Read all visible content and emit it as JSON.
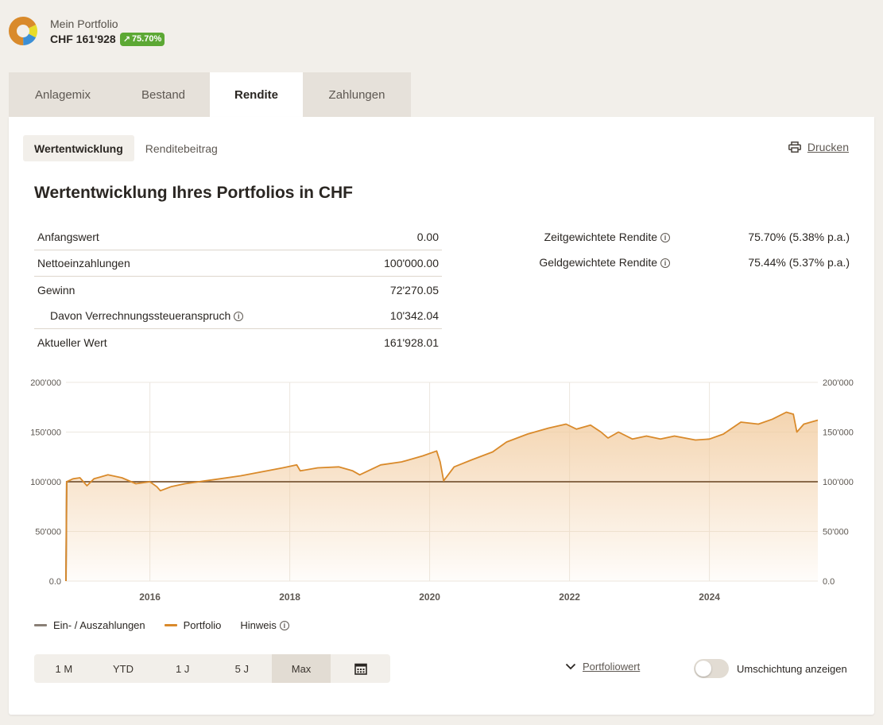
{
  "header": {
    "title": "Mein Portfolio",
    "value": "CHF 161'928",
    "badge": "75.70%",
    "badge_icon": "arrow-up-right-icon"
  },
  "tabs": [
    "Anlagemix",
    "Bestand",
    "Rendite",
    "Zahlungen"
  ],
  "active_tab": "Rendite",
  "subtabs": [
    "Wertentwicklung",
    "Renditebeitrag"
  ],
  "active_subtab": "Wertentwicklung",
  "print_label": "Drucken",
  "section_title": "Wertentwicklung Ihres Portfolios in CHF",
  "summary": [
    {
      "label": "Anfangswert",
      "value": "0.00"
    },
    {
      "label": "Nettoeinzahlungen",
      "value": "100'000.00"
    },
    {
      "label": "Gewinn",
      "value": "72'270.05"
    },
    {
      "label": "Davon Verrechnungssteueranspruch",
      "value": "10'342.04"
    },
    {
      "label": "Aktueller Wert",
      "value": "161'928.01"
    }
  ],
  "returns": [
    {
      "label": "Zeitgewichtete Rendite",
      "value": "75.70% (5.38% p.a.)"
    },
    {
      "label": "Geldgewichtete Rendite",
      "value": "75.44% (5.37% p.a.)"
    }
  ],
  "chart_data": {
    "type": "area",
    "y_tick_labels": [
      "200'000",
      "150'000",
      "100'000",
      "50'000",
      "0.0"
    ],
    "x_tick_labels": [
      "2016",
      "2018",
      "2020",
      "2022",
      "2024"
    ],
    "ylim": [
      0,
      200000
    ],
    "xlim": [
      2014.8,
      2025.55
    ],
    "grid": true,
    "series": [
      {
        "name": "Ein- / Auszahlungen",
        "color": "#8a6a4a",
        "points": [
          [
            2014.8,
            0
          ],
          [
            2014.81,
            100000
          ],
          [
            2025.55,
            100000
          ]
        ]
      },
      {
        "name": "Portfolio",
        "color": "#d98a2b",
        "points": [
          [
            2014.8,
            0
          ],
          [
            2014.81,
            100000
          ],
          [
            2014.9,
            103000
          ],
          [
            2015.0,
            104000
          ],
          [
            2015.1,
            96000
          ],
          [
            2015.2,
            103000
          ],
          [
            2015.4,
            107000
          ],
          [
            2015.6,
            104000
          ],
          [
            2015.8,
            98000
          ],
          [
            2016.0,
            100000
          ],
          [
            2016.1,
            95000
          ],
          [
            2016.15,
            91000
          ],
          [
            2016.3,
            95000
          ],
          [
            2016.5,
            98000
          ],
          [
            2016.7,
            100000
          ],
          [
            2017.0,
            103000
          ],
          [
            2017.3,
            106000
          ],
          [
            2017.6,
            110000
          ],
          [
            2017.9,
            114000
          ],
          [
            2018.1,
            117000
          ],
          [
            2018.15,
            111000
          ],
          [
            2018.4,
            114000
          ],
          [
            2018.7,
            115000
          ],
          [
            2018.9,
            111000
          ],
          [
            2019.0,
            107000
          ],
          [
            2019.3,
            117000
          ],
          [
            2019.6,
            120000
          ],
          [
            2019.9,
            126000
          ],
          [
            2020.1,
            131000
          ],
          [
            2020.15,
            120000
          ],
          [
            2020.2,
            101000
          ],
          [
            2020.35,
            115000
          ],
          [
            2020.6,
            122000
          ],
          [
            2020.9,
            130000
          ],
          [
            2021.1,
            140000
          ],
          [
            2021.4,
            148000
          ],
          [
            2021.7,
            154000
          ],
          [
            2021.95,
            158000
          ],
          [
            2022.1,
            153000
          ],
          [
            2022.3,
            157000
          ],
          [
            2022.45,
            150000
          ],
          [
            2022.55,
            144000
          ],
          [
            2022.7,
            150000
          ],
          [
            2022.9,
            143000
          ],
          [
            2023.1,
            146000
          ],
          [
            2023.3,
            143000
          ],
          [
            2023.5,
            146000
          ],
          [
            2023.8,
            142000
          ],
          [
            2024.0,
            143000
          ],
          [
            2024.2,
            148000
          ],
          [
            2024.45,
            160000
          ],
          [
            2024.7,
            158000
          ],
          [
            2024.9,
            163000
          ],
          [
            2025.1,
            170000
          ],
          [
            2025.2,
            168000
          ],
          [
            2025.25,
            150000
          ],
          [
            2025.35,
            158000
          ],
          [
            2025.55,
            162000
          ]
        ]
      }
    ]
  },
  "legend": {
    "items": [
      {
        "label": "Ein- / Auszahlungen",
        "color": "#8a7f76"
      },
      {
        "label": "Portfolio",
        "color": "#d98a2b"
      }
    ],
    "hint": "Hinweis"
  },
  "ranges": [
    "1 M",
    "YTD",
    "1 J",
    "5 J",
    "Max"
  ],
  "active_range": "Max",
  "portfoliowert_label": "Portfoliowert",
  "toggle_label": "Umschichtung anzeigen",
  "toggle_on": false
}
